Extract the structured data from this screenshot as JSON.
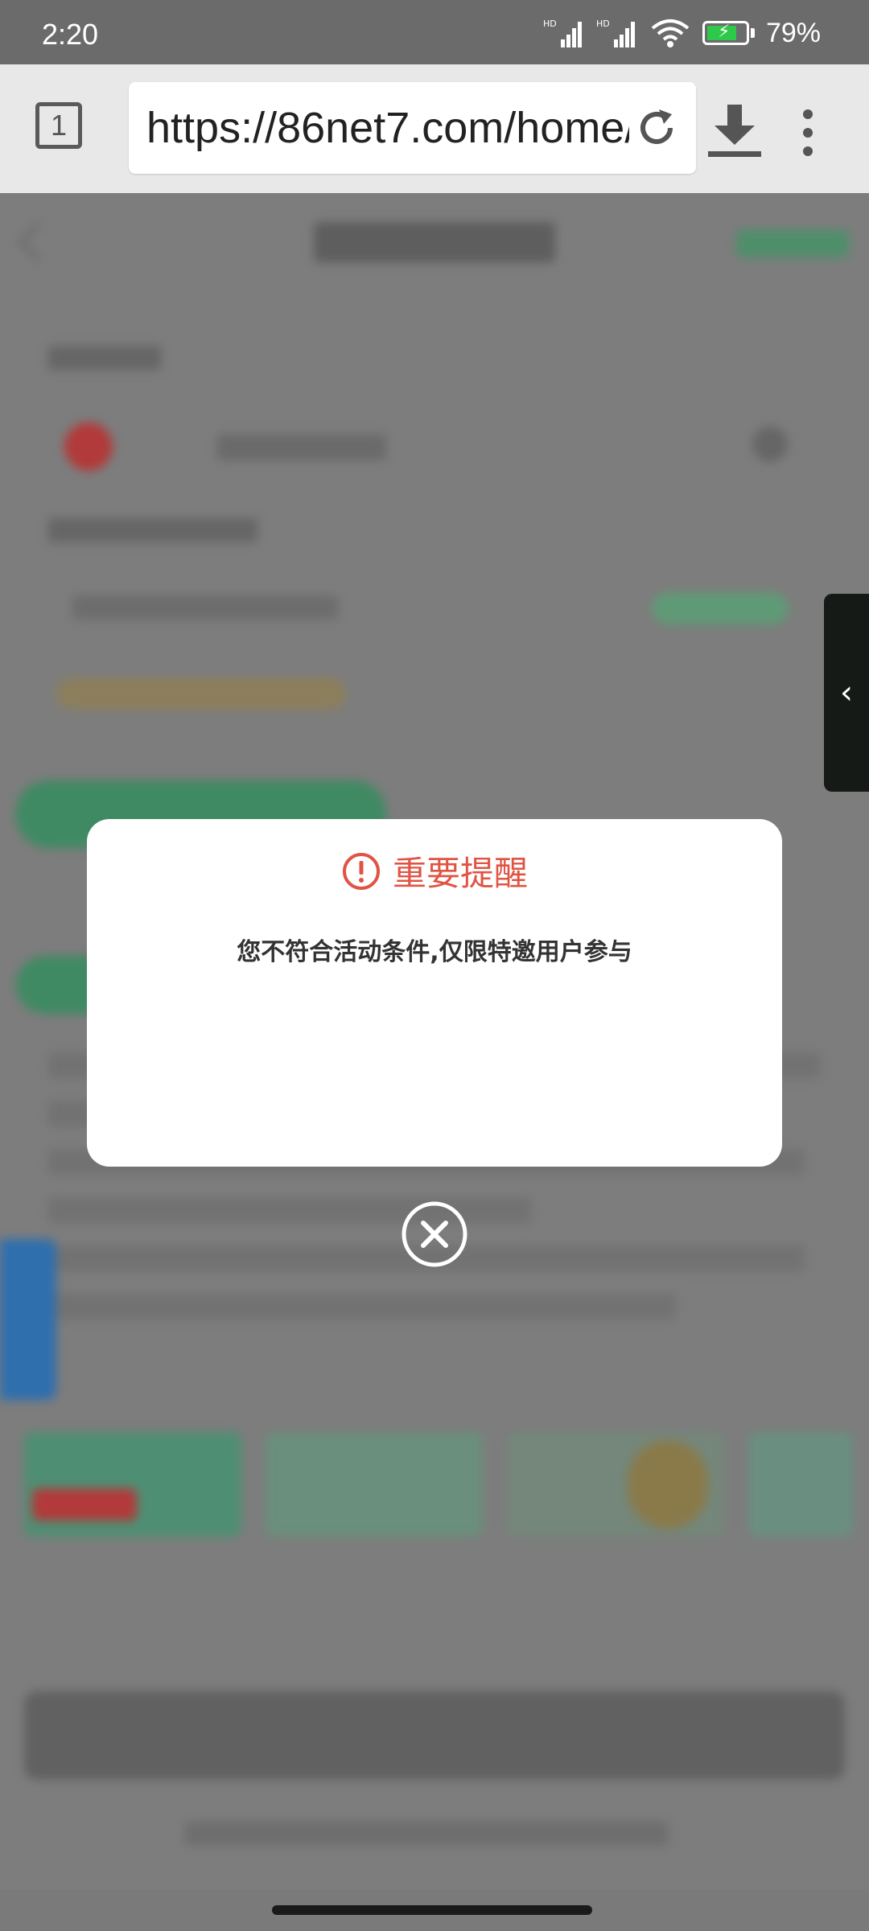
{
  "status_bar": {
    "time": "2:20",
    "battery_percent": "79%",
    "battery_level": 0.79
  },
  "browser": {
    "tab_count": "1",
    "url": "https://86net7.com/home/"
  },
  "side_tab": {
    "icon": "chevron-left-icon",
    "glyph": "‹"
  },
  "dialog": {
    "title": "重要提醒",
    "message": "您不符合活动条件,仅限特邀用户参与",
    "title_color": "#e05444",
    "close_icon": "close-circle-icon"
  }
}
